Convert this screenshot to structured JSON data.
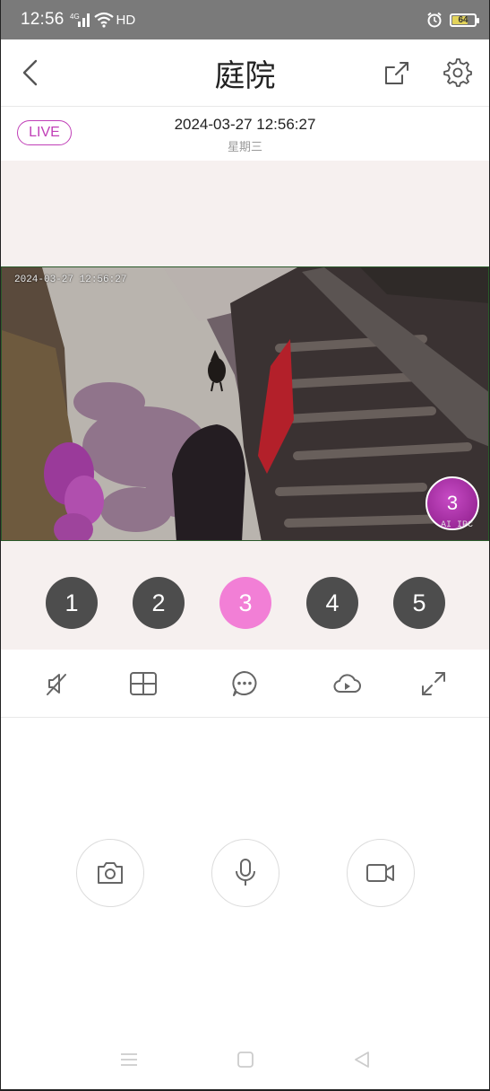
{
  "status_bar": {
    "time": "12:56",
    "network": "4G",
    "hd": "HD",
    "battery": "64",
    "colors": {
      "background": "#7a7a7a",
      "battery_fill": "#e2d35a"
    }
  },
  "header": {
    "title": "庭院",
    "icons": {
      "back": "chevron-left-icon",
      "share": "share-icon",
      "settings": "gear-icon"
    }
  },
  "live": {
    "badge": "LIVE",
    "datetime": "2024-03-27 12:56:27",
    "weekday": "星期三",
    "accent": "#c03fb7"
  },
  "video": {
    "osd_timestamp": "2024-03-27 12:56:27",
    "ai_badge_number": "3",
    "ai_badge_text": "AI IPC"
  },
  "channels": [
    {
      "label": "1",
      "active": false
    },
    {
      "label": "2",
      "active": false
    },
    {
      "label": "3",
      "active": true
    },
    {
      "label": "4",
      "active": false
    },
    {
      "label": "5",
      "active": false
    }
  ],
  "channel_colors": {
    "normal": "#4d4d4d",
    "active": "#f27fd6"
  },
  "toolbar": {
    "icons": [
      "sound-off-icon",
      "split-screen-icon",
      "message-icon",
      "cloud-playback-icon",
      "fullscreen-icon"
    ]
  },
  "actions": {
    "icons": [
      "camera-icon",
      "microphone-icon",
      "video-record-icon"
    ]
  },
  "navbar": {
    "icons": [
      "menu-icon",
      "home-icon",
      "back-triangle-icon"
    ]
  }
}
